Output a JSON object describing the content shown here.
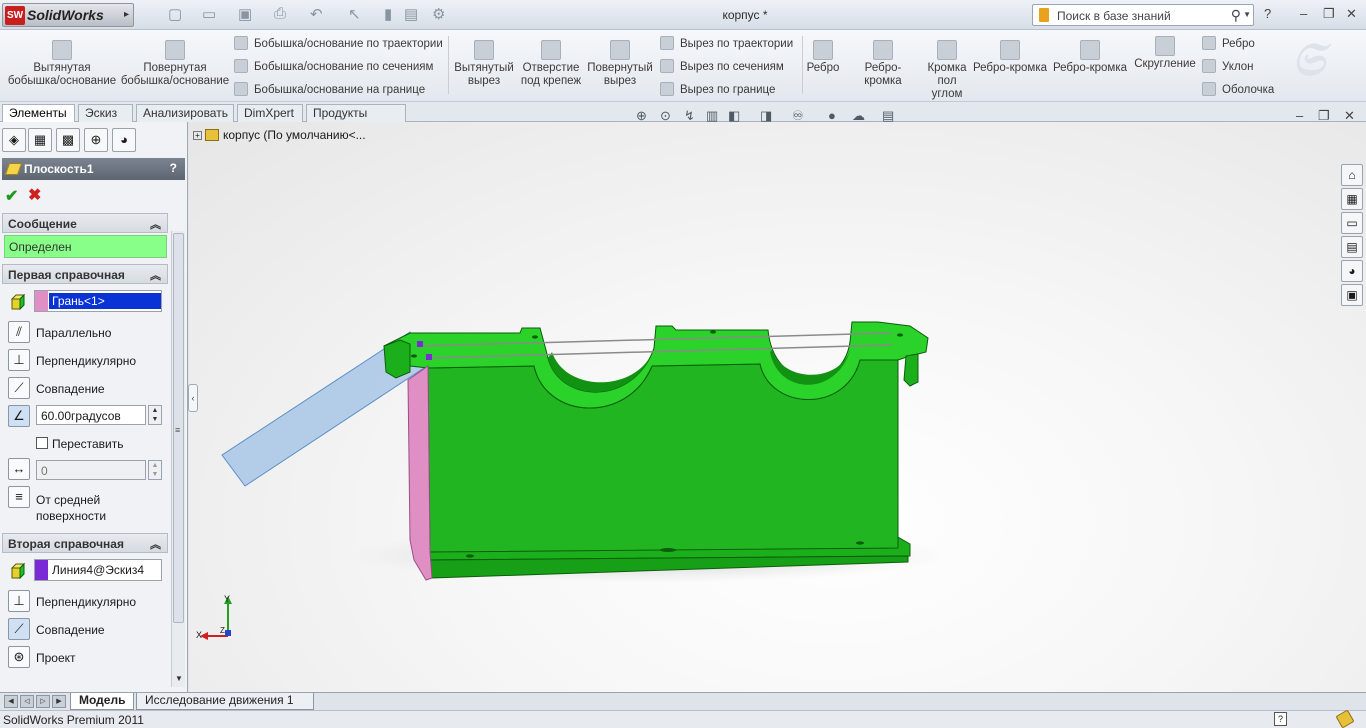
{
  "app": {
    "brand": "SolidWorks",
    "document_title": "корпус *",
    "search_placeholder": "Поиск в базе знаний",
    "help": "?"
  },
  "ribbon": {
    "extrude_boss": "Вытянутая бобышка/основание",
    "revolve_boss": "Повернутая бобышка/основание",
    "sweep_boss": "Бобышка/основание по траектории",
    "loft_boss": "Бобышка/основание по сечениям",
    "boundary_boss": "Бобышка/основание на границе",
    "extrude_cut": "Вытянутый вырез",
    "hole_wizard": "Отверстие под крепеж",
    "revolve_cut": "Повернутый вырез",
    "sweep_cut": "Вырез по траектории",
    "loft_cut": "Вырез по сечениям",
    "boundary_cut": "Вырез по границе",
    "rib1": "Ребро",
    "rib_edge1": "Ребро-кромка",
    "corner_edge": "Кромка пол углом",
    "rib_edge2": "Ребро-кромка",
    "rib_edge3": "Ребро-кромка",
    "fillet": "Скругление",
    "rib2": "Ребро",
    "draft": "Уклон",
    "shell": "Оболочка"
  },
  "tabs": [
    "Элементы",
    "Эскиз",
    "Анализировать",
    "DimXpert",
    "Продукты Office"
  ],
  "tree": {
    "label": "корпус  (По умолчанию<..."
  },
  "property_manager": {
    "title": "Плоскость1",
    "help": "?",
    "message_header": "Сообщение",
    "message_text": "Определен",
    "first_ref_header": "Первая справочная",
    "first_ref_value": "Грань<1>",
    "parallel": "Параллельно",
    "perpendicular": "Перпендикулярно",
    "coincident": "Совпадение",
    "angle_value": "60.00градусов",
    "flip": "Переставить",
    "distance_value": "0",
    "mid_plane": "От средней поверхности",
    "second_ref_header": "Вторая справочная",
    "second_ref_value": "Линия4@Эскиз4",
    "perpendicular2": "Перпендикулярно",
    "coincident2": "Совпадение",
    "project": "Проект"
  },
  "triad": {
    "y": "Y",
    "x": "X",
    "z": "Z"
  },
  "bottom_tabs": [
    "Модель",
    "Исследование движения 1"
  ],
  "status": {
    "text": "SolidWorks Premium 2011",
    "help": "?"
  },
  "colors": {
    "part_green": "#1fbf1f",
    "part_green_dark": "#128a12",
    "plane_blue": "#9fc0e0",
    "face_pink": "#e08fc4",
    "selection_blue": "#0a33d6",
    "message_green": "#88ff88"
  }
}
